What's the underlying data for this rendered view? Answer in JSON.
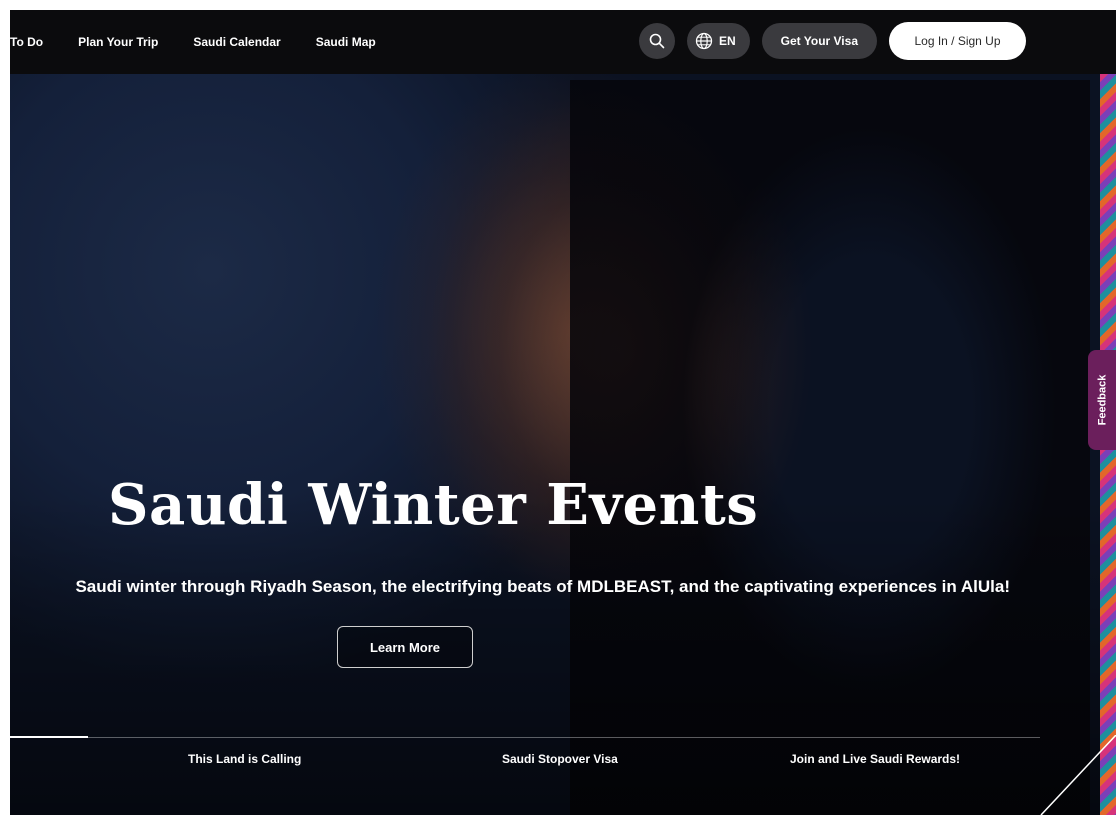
{
  "nav": {
    "links": [
      "To Do",
      "Plan Your Trip",
      "Saudi Calendar",
      "Saudi Map"
    ],
    "language": "EN",
    "visa_label": "Get Your Visa",
    "login_label": "Log In / Sign Up"
  },
  "feedback_label": "Feedback",
  "hero": {
    "title": "Saudi Winter Events",
    "subtitle": "Saudi winter through Riyadh Season, the electrifying beats of MDLBEAST, and the captivating experiences in AlUla!",
    "cta_label": "Learn More"
  },
  "carousel": {
    "tabs": [
      "This Land is Calling",
      "Saudi Stopover Visa",
      "Join and Live Saudi Rewards!"
    ]
  },
  "icons": {
    "search": "search-icon",
    "globe": "globe-icon"
  }
}
